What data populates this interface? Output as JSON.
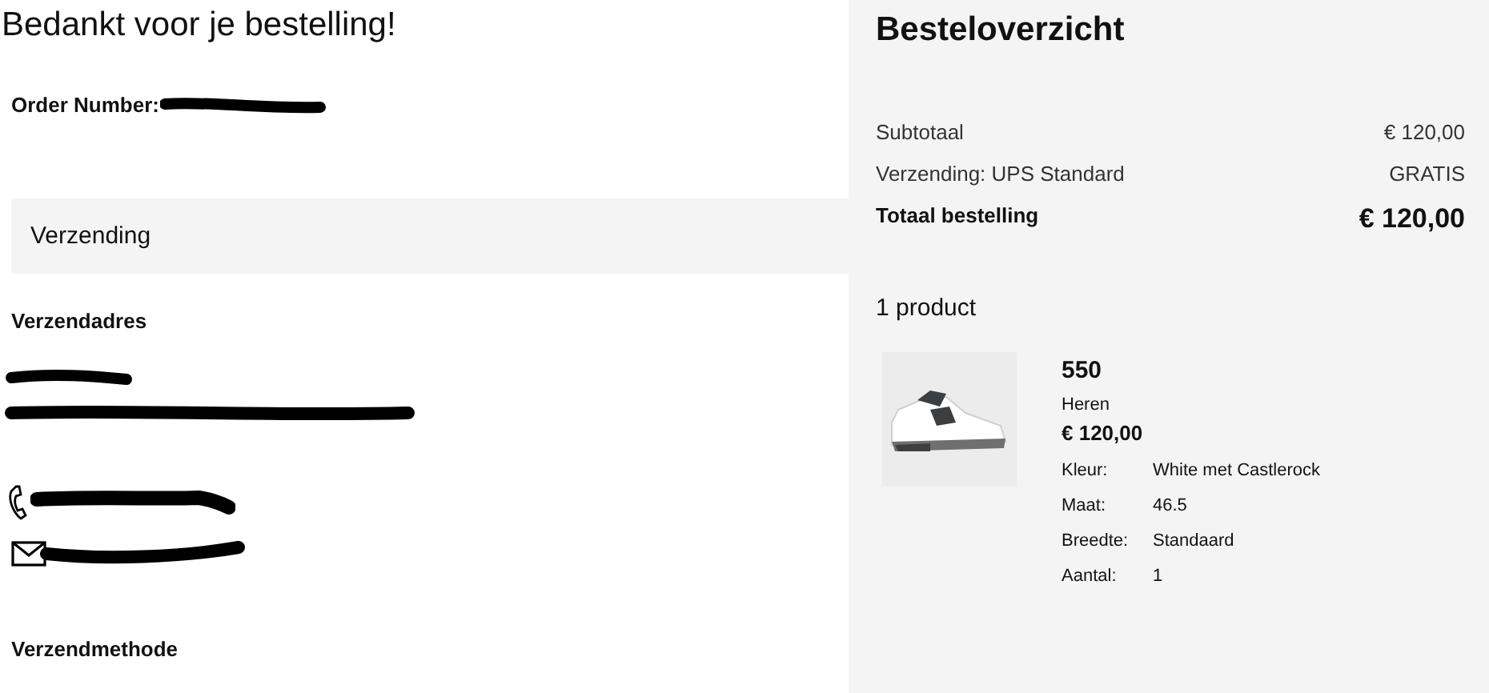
{
  "left": {
    "title": "Bedankt voor je bestelling!",
    "order_number_label": "Order Number:",
    "shipping_panel": "Verzending",
    "address_heading": "Verzendadres",
    "method_heading": "Verzendmethode"
  },
  "summary": {
    "title": "Besteloverzicht",
    "rows": [
      {
        "label": "Subtotaal",
        "value": "€ 120,00",
        "kind": "normal"
      },
      {
        "label": "Verzending: UPS Standard",
        "value": "GRATIS",
        "kind": "normal"
      },
      {
        "label": "Totaal bestelling",
        "value": "€ 120,00",
        "kind": "total"
      }
    ],
    "count": "1 product",
    "product": {
      "kind": "picture",
      "name": "550",
      "gender": "Heren",
      "price": "€ 120,00",
      "attributes": [
        {
          "label": "Kleur:",
          "value": "White met Castlerock"
        },
        {
          "label": "Maat:",
          "value": "46.5"
        },
        {
          "label": "Breedte:",
          "value": "Standaard"
        },
        {
          "label": "Aantal:",
          "value": "1"
        }
      ]
    }
  }
}
